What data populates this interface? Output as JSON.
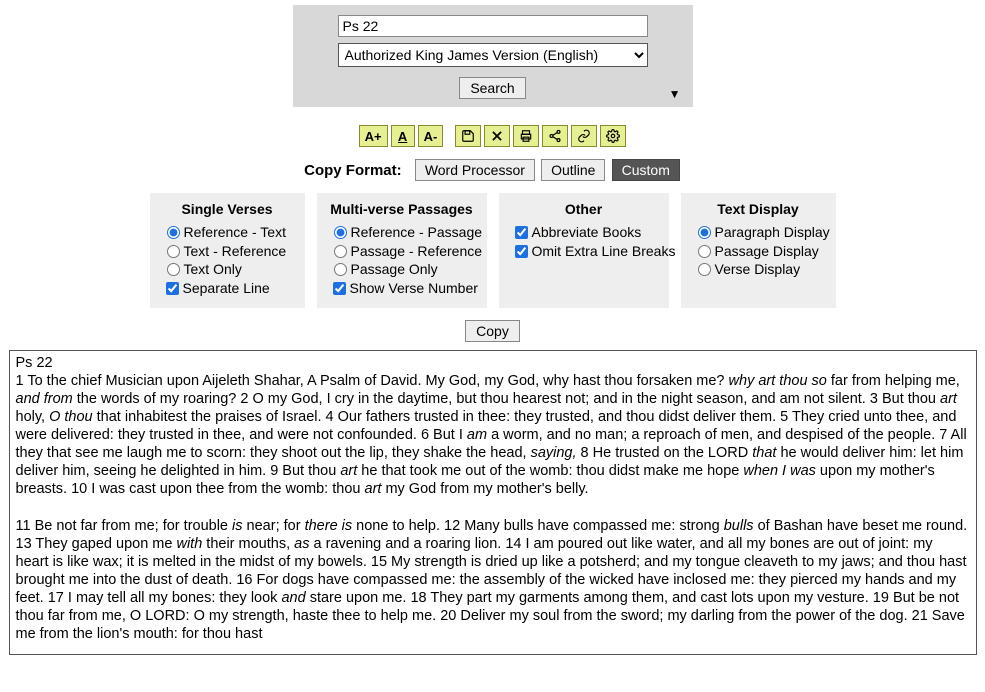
{
  "search": {
    "query": "Ps 22",
    "version": "Authorized King James Version (English)",
    "button": "Search"
  },
  "toolbar": {
    "inc": "A+",
    "single": "A",
    "dec": "A-"
  },
  "copyFormat": {
    "label": "Copy Format:",
    "wp": "Word Processor",
    "outline": "Outline",
    "custom": "Custom"
  },
  "panels": {
    "single": {
      "title": "Single Verses",
      "refText": "Reference - Text",
      "textRef": "Text - Reference",
      "textOnly": "Text Only",
      "sepLine": "Separate Line"
    },
    "multi": {
      "title": "Multi-verse Passages",
      "refPass": "Reference - Passage",
      "passRef": "Passage - Reference",
      "passOnly": "Passage Only",
      "showVn": "Show Verse Number"
    },
    "other": {
      "title": "Other",
      "abbrev": "Abbreviate Books",
      "omit": "Omit Extra Line Breaks"
    },
    "display": {
      "title": "Text Display",
      "para": "Paragraph Display",
      "pass": "Passage Display",
      "verse": "Verse Display"
    }
  },
  "copyBtn": "Copy",
  "passage": {
    "ref": "Ps 22",
    "para1": "1 To the chief Musician upon Aijeleth Shahar, A Psalm of David. My God, my God, why hast thou forsaken me? <i>why art thou so</i> far from helping me, <i>and from</i> the words of my roaring?  2 O my God, I cry in the daytime, but thou hearest not; and in the night season, and am not silent.  3 But thou <i>art</i> holy, <i>O thou</i> that inhabitest the praises of Israel.  4 Our fathers trusted in thee: they trusted, and thou didst deliver them.  5 They cried unto thee, and were delivered: they trusted in thee, and were not confounded.  6 But I <i>am</i> a worm, and no man; a reproach of men, and despised of the people.  7 All they that see me laugh me to scorn: they shoot out the lip, they shake the head, <i>saying,</i>  8 He trusted on the LORD <i>that</i> he would deliver him: let him deliver him, seeing he delighted in him.  9 But thou <i>art</i> he that took me out of the womb: thou didst make me hope <i>when I was</i> upon my mother's breasts.  10 I was cast upon thee from the womb: thou <i>art</i> my God from my mother's belly.",
    "para2": "11 Be not far from me; for trouble <i>is</i> near; for <i>there is</i> none to help.  12 Many bulls have compassed me: strong <i>bulls</i> of Bashan have beset me round.  13 They gaped upon me <i>with</i> their mouths, <i>as</i> a ravening and a roaring lion.  14 I am poured out like water, and all my bones are out of joint: my heart is like wax; it is melted in the midst of my bowels.  15 My strength is dried up like a potsherd; and my tongue cleaveth to my jaws; and thou hast brought me into the dust of death.  16 For dogs have compassed me: the assembly of the wicked have inclosed me: they pierced my hands and my feet.  17 I may tell all my bones: they look <i>and</i> stare upon me.  18 They part my garments among them, and cast lots upon my vesture.  19 But be not thou far from me, O LORD: O my strength, haste thee to help me.  20 Deliver my soul from the sword; my darling from the power of the dog.  21 Save me from the lion's mouth: for thou hast"
  }
}
